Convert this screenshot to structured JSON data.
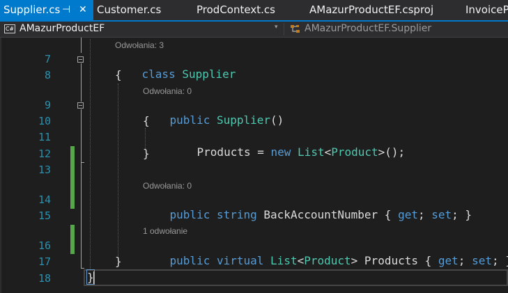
{
  "tabs": [
    {
      "label": "Supplier.cs",
      "active": true,
      "pin": "⊣",
      "close": "✕"
    },
    {
      "label": "Customer.cs"
    },
    {
      "label": "ProdContext.cs"
    },
    {
      "label": "AMazurProductEF.csproj"
    },
    {
      "label": "InvoicePr"
    }
  ],
  "navbar": {
    "project_badge": "C#",
    "project": "AMazurProductEF",
    "dropdown_glyph": "▾",
    "member": "AMazurProductEF.Supplier"
  },
  "line_numbers": [
    "7",
    "8",
    "9",
    "10",
    "11",
    "12",
    "13",
    "14",
    "15",
    "16",
    "17",
    "18"
  ],
  "codelens": {
    "class_refs": "Odwołania: 3",
    "ctor_refs": "Odwołania: 0",
    "account_refs": "Odwołania: 0",
    "products_refs": "1 odwołanie"
  },
  "code": {
    "l7": {
      "kw": "class",
      "type": "Supplier"
    },
    "l8": "{",
    "l9": {
      "kw": "public",
      "type": "Supplier",
      "rest": "()"
    },
    "l10": "{",
    "l11": {
      "lhs": "Products = ",
      "kw": "new",
      "type1": "List",
      "lt": "<",
      "type2": "Product",
      "rest": ">();"
    },
    "l12": "}",
    "l14": {
      "kw1": "public",
      "kw2": "string",
      "name": "BackAccountNumber { ",
      "get": "get",
      "semi1": "; ",
      "set": "set",
      "end": "; }"
    },
    "l16": {
      "kw1": "public",
      "kw2": "virtual",
      "type1": "List",
      "lt": "<",
      "type2": "Product",
      "gt": "> Products { ",
      "get": "get",
      "semi1": "; ",
      "set": "set",
      "end": "; }"
    },
    "l17": "}",
    "l18": "}"
  },
  "colors": {
    "keyword": "#569cd6",
    "type": "#4ec9b0",
    "line_number": "#2b91af",
    "accent": "#007acc",
    "change_marker": "#57a64a"
  }
}
